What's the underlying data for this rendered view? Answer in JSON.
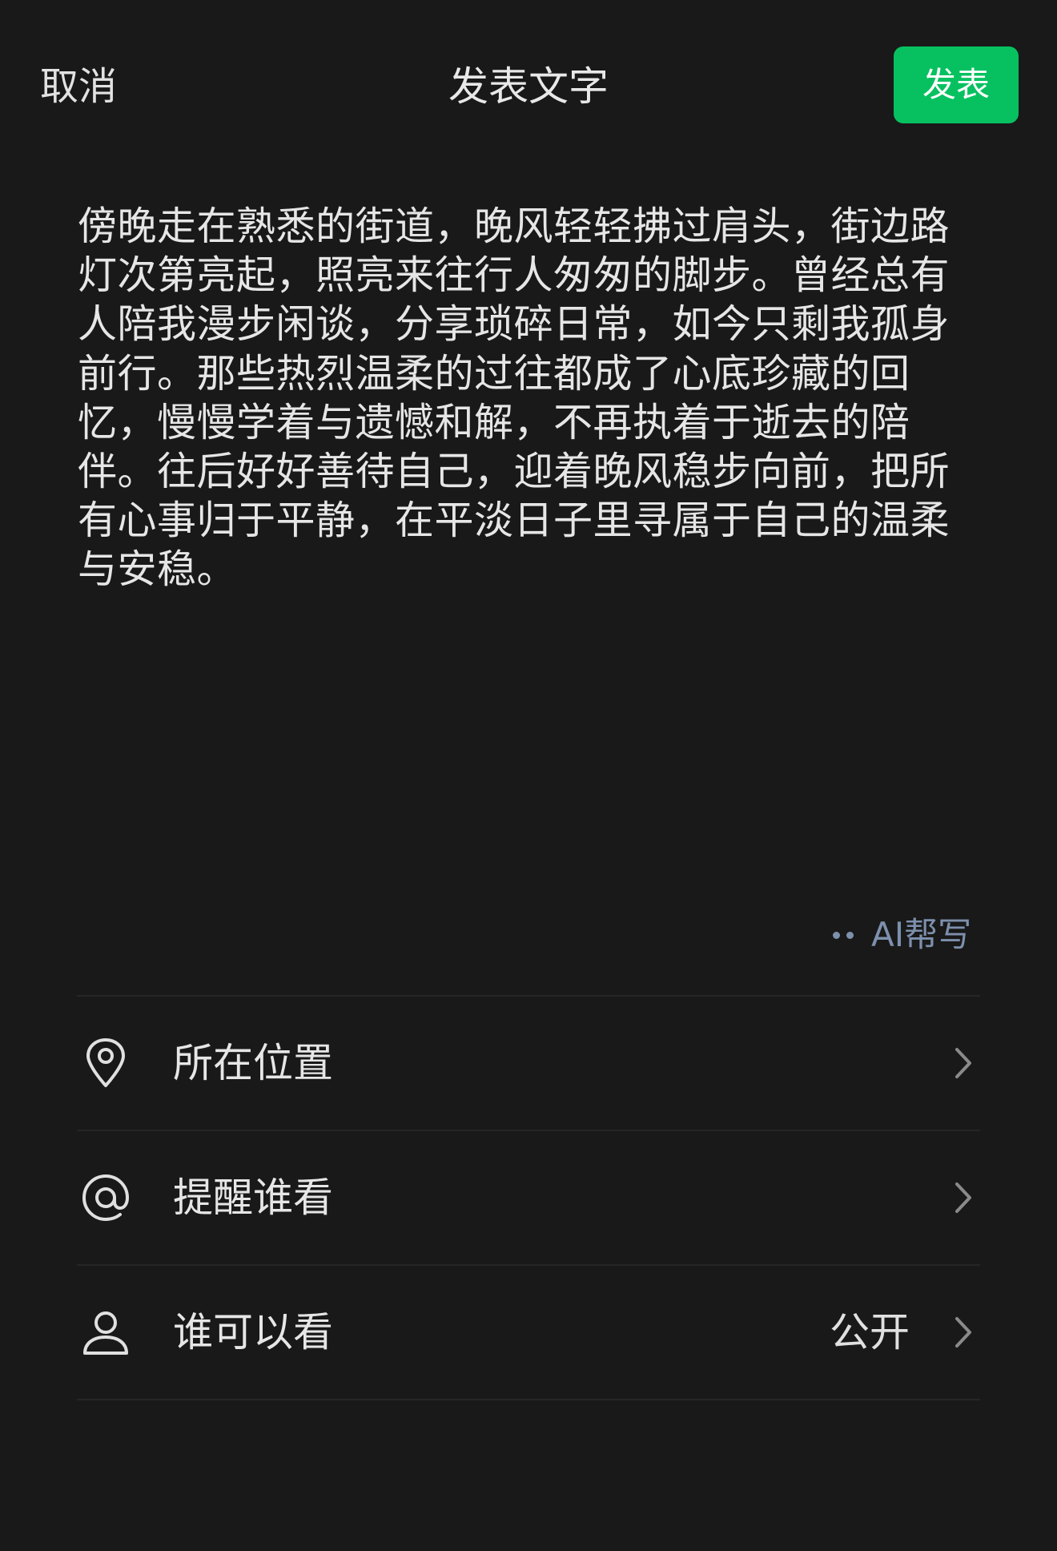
{
  "header": {
    "cancel_label": "取消",
    "title": "发表文字",
    "publish_label": "发表"
  },
  "post": {
    "text": "傍晚走在熟悉的街道，晚风轻轻拂过肩头，街边路灯次第亮起，照亮来往行人匆匆的脚步。曾经总有人陪我漫步闲谈，分享琐碎日常，如今只剩我孤身前行。那些热烈温柔的过往都成了心底珍藏的回忆，慢慢学着与遗憾和解，不再执着于逝去的陪伴。往后好好善待自己，迎着晚风稳步向前，把所有心事归于平静，在平淡日子里寻属于自己的温柔与安稳。"
  },
  "ai_help": {
    "label": "AI帮写",
    "icon": "two-dots-icon"
  },
  "options": [
    {
      "label": "所在位置",
      "icon": "location-pin-icon",
      "value": ""
    },
    {
      "label": "提醒谁看",
      "icon": "at-sign-icon",
      "value": ""
    },
    {
      "label": "谁可以看",
      "icon": "person-icon",
      "value": "公开"
    }
  ],
  "colors": {
    "background": "#191919",
    "accent": "#07c160",
    "ai_link": "#7d90ad",
    "divider": "#262626"
  }
}
